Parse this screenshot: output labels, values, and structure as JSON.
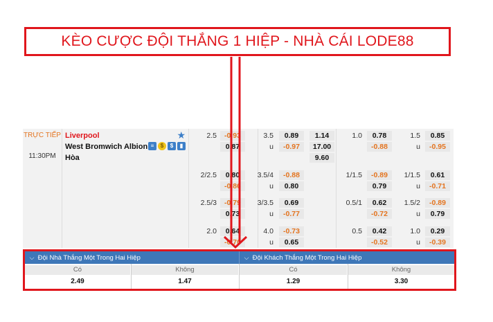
{
  "banner": {
    "title": "KÈO CƯỢC ĐỘI THẮNG 1 HIỆP - NHÀ CÁI LODE88"
  },
  "match": {
    "status": "TRỰC TIẾP",
    "time": "11:30PM",
    "home_team": "Liverpool",
    "away_team": "West Bromwich Albion",
    "draw_label": "Hòa"
  },
  "odds_rows": [
    {
      "ft_hdp": {
        "line": "2.5",
        "home": "-0.93",
        "away": "0.87"
      },
      "ft_ou": {
        "line": "3.5",
        "u": "u",
        "over": "0.89",
        "under": "-0.97"
      },
      "ft_1x2": {
        "home": "1.14",
        "away": "17.00",
        "draw": "9.60"
      },
      "h1_hdp": {
        "line": "1.0",
        "home": "0.78",
        "away": "-0.88"
      },
      "h1_ou": {
        "line": "1.5",
        "u": "u",
        "over": "0.85",
        "under": "-0.95"
      }
    },
    {
      "ft_hdp": {
        "line": "2/2.5",
        "home": "0.80",
        "away": "-0.86"
      },
      "ft_ou": {
        "line": "3.5/4",
        "u": "u",
        "over": "-0.88",
        "under": "0.80"
      },
      "h1_hdp": {
        "line": "1/1.5",
        "home": "-0.89",
        "away": "0.79"
      },
      "h1_ou": {
        "line": "1/1.5",
        "u": "u",
        "over": "0.61",
        "under": "-0.71"
      }
    },
    {
      "ft_hdp": {
        "line": "2.5/3",
        "home": "-0.79",
        "away": "0.73"
      },
      "ft_ou": {
        "line": "3/3.5",
        "u": "u",
        "over": "0.69",
        "under": "-0.77"
      },
      "h1_hdp": {
        "line": "0.5/1",
        "home": "0.62",
        "away": "-0.72"
      },
      "h1_ou": {
        "line": "1.5/2",
        "u": "u",
        "over": "-0.89",
        "under": "0.79"
      }
    },
    {
      "ft_hdp": {
        "line": "2.0",
        "home": "0.64",
        "away": "-0.70"
      },
      "ft_ou": {
        "line": "4.0",
        "u": "u",
        "over": "-0.73",
        "under": "0.65"
      },
      "h1_hdp": {
        "line": "0.5",
        "home": "0.42",
        "away": "-0.52"
      },
      "h1_ou": {
        "line": "1.0",
        "u": "u",
        "over": "0.29",
        "under": "-0.39"
      }
    }
  ],
  "half_win": {
    "home_header": "Đội Nhà Thắng Một Trong Hai Hiệp",
    "away_header": "Đội Khách Thắng Một Trong Hai Hiệp",
    "yes_label": "Có",
    "no_label": "Không",
    "home_yes": "2.49",
    "home_no": "1.47",
    "away_yes": "1.29",
    "away_no": "3.30"
  },
  "colors": {
    "accent_red": "#e0161c",
    "header_blue": "#3e77b8",
    "negative_orange": "#e4741f",
    "star_blue": "#3d7fc8"
  },
  "icons": [
    "star-icon",
    "stats-icon",
    "coin-icon",
    "dollar-icon",
    "chart-icon",
    "chevron-down-icon",
    "arrow-down-icon"
  ]
}
